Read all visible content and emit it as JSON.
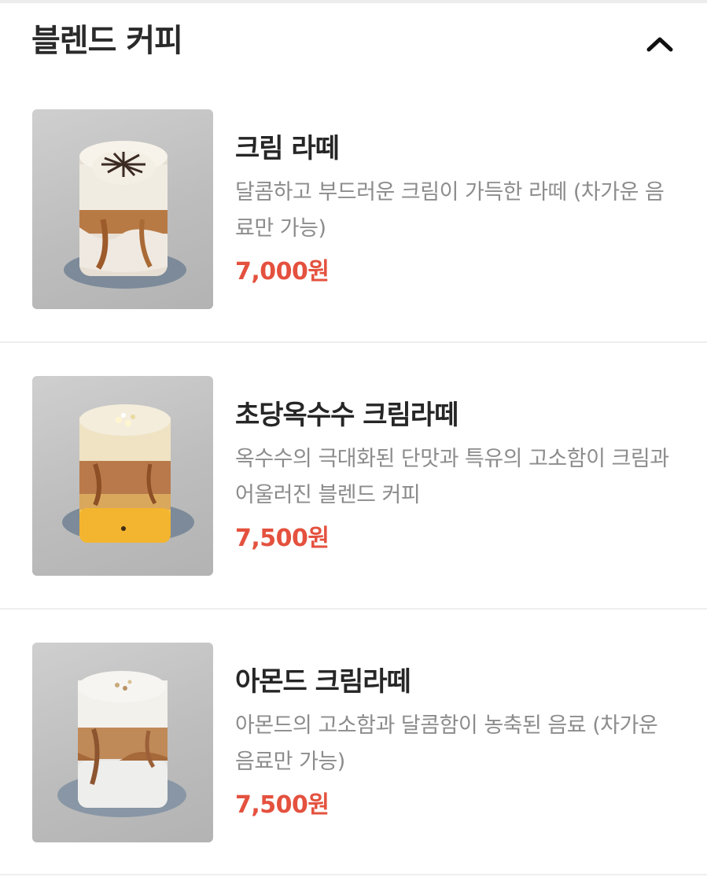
{
  "section": {
    "title": "블렌드 커피",
    "toggle_icon": "chevron-up-icon"
  },
  "colors": {
    "price": "#e4513e",
    "name": "#262626",
    "description": "#8c8c8c",
    "divider": "#eeeeee"
  },
  "menu_items": [
    {
      "name": "크림 라떼",
      "description": "달콤하고 부드러운 크림이 가득한 라떼 (차가운 음료만 가능)",
      "price": "7,000원",
      "image_icon": "cream-latte-photo"
    },
    {
      "name": "초당옥수수 크림라떼",
      "description": "옥수수의 극대화된 단맛과 특유의 고소함이 크림과 어울러진 블렌드 커피",
      "price": "7,500원",
      "image_icon": "corn-cream-latte-photo"
    },
    {
      "name": "아몬드 크림라떼",
      "description": "아몬드의 고소함과 달콤함이 농축된 음료 (차가운 음료만 가능)",
      "price": "7,500원",
      "image_icon": "almond-cream-latte-photo"
    }
  ]
}
